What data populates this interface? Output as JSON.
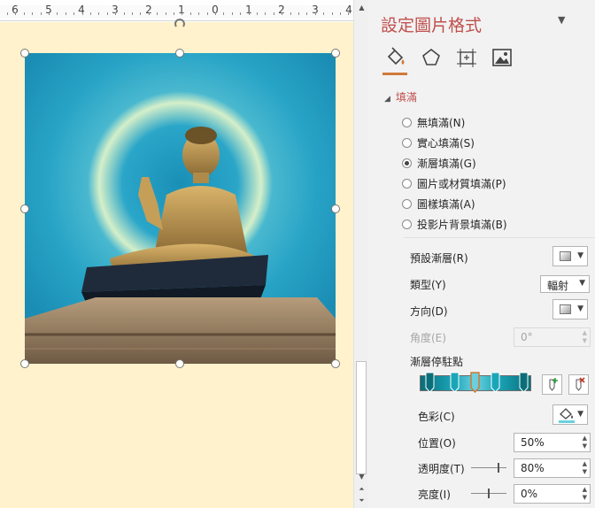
{
  "ruler": {
    "labels": [
      "6",
      "5",
      "4",
      "3",
      "2",
      "1",
      "0",
      "1",
      "2",
      "3",
      "4"
    ]
  },
  "pane": {
    "title": "設定圖片格式",
    "tabs": [
      {
        "icon": "fill-bucket-icon"
      },
      {
        "icon": "pentagon-effects-icon"
      },
      {
        "icon": "size-layout-icon"
      },
      {
        "icon": "picture-icon"
      }
    ],
    "fill_section": {
      "header": "填滿",
      "options": [
        {
          "label": "無填滿(N)",
          "selected": false
        },
        {
          "label": "實心填滿(S)",
          "selected": false
        },
        {
          "label": "漸層填滿(G)",
          "selected": true
        },
        {
          "label": "圖片或材質填滿(P)",
          "selected": false
        },
        {
          "label": "圖樣填滿(A)",
          "selected": false
        },
        {
          "label": "投影片背景填滿(B)",
          "selected": false
        }
      ],
      "preset_label": "預設漸層(R)",
      "type_label": "類型(Y)",
      "type_value": "輻射",
      "direction_label": "方向(D)",
      "angle_label": "角度(E)",
      "angle_value": "0°",
      "stops_label": "漸層停駐點",
      "color_label": "色彩(C)",
      "position_label": "位置(O)",
      "position_value": "50%",
      "transparency_label": "透明度(T)",
      "transparency_value": "80%",
      "transparency_level": 0.8,
      "brightness_label": "亮度(I)",
      "brightness_value": "0%",
      "brightness_level": 0.5
    }
  },
  "colors": {
    "accent": "#c0504d",
    "slide_bg": "#fff2cc",
    "pane_bg": "#f2f2f2",
    "gradient_dark": "#0a6e7a",
    "gradient_light": "#6bd0dd",
    "selected_stop": "#d0793a"
  }
}
